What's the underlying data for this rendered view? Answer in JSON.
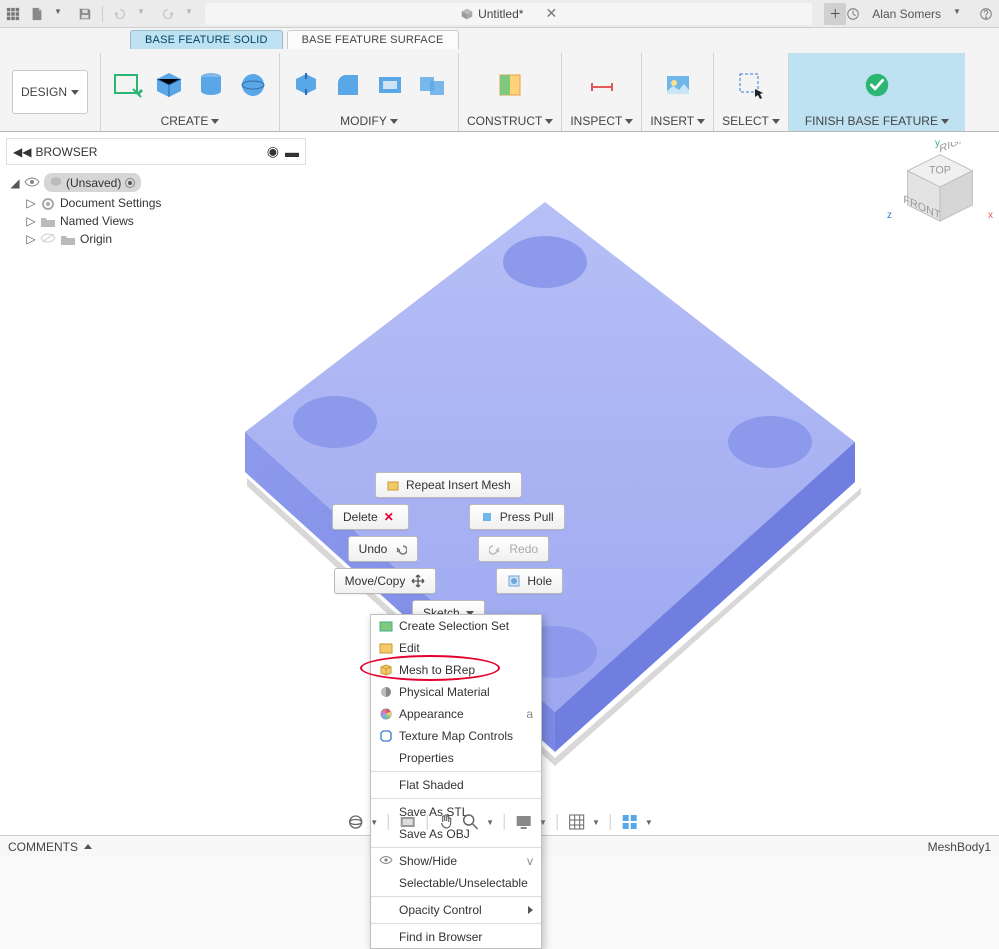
{
  "titlebar": {
    "title": "Untitled*",
    "user_name": "Alan Somers"
  },
  "ribbon": {
    "tabs": [
      {
        "label": "BASE FEATURE SOLID",
        "active": true
      },
      {
        "label": "BASE FEATURE SURFACE",
        "active": false
      }
    ],
    "workspace_label": "DESIGN",
    "groups": {
      "create": "CREATE",
      "modify": "MODIFY",
      "construct": "CONSTRUCT",
      "inspect": "INSPECT",
      "insert": "INSERT",
      "select": "SELECT",
      "finish": "FINISH BASE FEATURE"
    }
  },
  "browser": {
    "title": "BROWSER",
    "root": "(Unsaved)",
    "items": [
      {
        "label": "Document Settings"
      },
      {
        "label": "Named Views"
      },
      {
        "label": "Origin"
      }
    ]
  },
  "viewcube": {
    "top": "TOP",
    "front": "FRONT",
    "right": "RIGHT",
    "x": "x",
    "y": "y",
    "z": "z"
  },
  "context": {
    "repeat": "Repeat Insert Mesh",
    "delete": "Delete",
    "press_pull": "Press Pull",
    "undo": "Undo",
    "redo": "Redo",
    "move_copy": "Move/Copy",
    "hole": "Hole",
    "sketch": "Sketch"
  },
  "context_menu": {
    "items": [
      {
        "label": "Create Selection Set",
        "icon": "selection-set-icon"
      },
      {
        "label": "Edit",
        "icon": "edit-icon"
      },
      {
        "label": "Mesh to BRep",
        "icon": "mesh-brep-icon"
      },
      {
        "label": "Physical Material",
        "icon": "material-icon"
      },
      {
        "label": "Appearance",
        "icon": "appearance-icon",
        "shortcut": "a"
      },
      {
        "label": "Texture Map Controls",
        "icon": "texture-icon"
      },
      {
        "label": "Properties"
      },
      {
        "sep": true
      },
      {
        "label": "Flat Shaded"
      },
      {
        "sep": true
      },
      {
        "label": "Save As STL"
      },
      {
        "label": "Save As OBJ"
      },
      {
        "sep": true
      },
      {
        "label": "Show/Hide",
        "icon": "eye-icon",
        "shortcut": "v"
      },
      {
        "label": "Selectable/Unselectable"
      },
      {
        "sep": true
      },
      {
        "label": "Opacity Control",
        "submenu": true
      },
      {
        "sep": true
      },
      {
        "label": "Find in Browser"
      }
    ]
  },
  "footer": {
    "comments": "COMMENTS",
    "status": "MeshBody1"
  }
}
